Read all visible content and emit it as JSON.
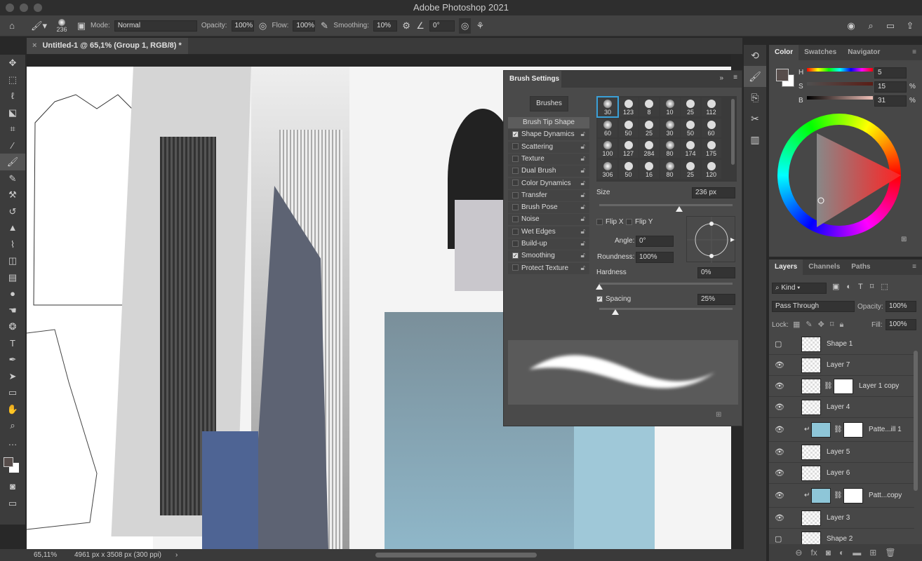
{
  "app": {
    "title": "Adobe Photoshop 2021"
  },
  "options": {
    "brush_size": "236",
    "mode_label": "Mode:",
    "mode": "Normal",
    "opacity_label": "Opacity:",
    "opacity": "100%",
    "flow_label": "Flow:",
    "flow": "100%",
    "smoothing_label": "Smoothing:",
    "smoothing": "10%",
    "angle": "0°"
  },
  "document": {
    "tab": "Untitled-1 @ 65,1% (Group 1, RGB/8) *"
  },
  "status": {
    "zoom": "65,11%",
    "size": "4961 px x 3508 px (300 ppi)"
  },
  "toolbar": {
    "tools": [
      "move",
      "marquee",
      "lasso",
      "object-select",
      "crop",
      "eyedropper",
      "brush",
      "pencil",
      "clone-stamp",
      "history-brush",
      "stamp",
      "mixer-brush",
      "eraser",
      "gradient",
      "blur",
      "smudge",
      "sponge",
      "type",
      "pen",
      "path-select",
      "rectangle",
      "hand",
      "zoom",
      "more"
    ]
  },
  "brush_settings": {
    "title": "Brush Settings",
    "brushes_button": "Brushes",
    "items": [
      {
        "label": "Brush Tip Shape",
        "checked": null
      },
      {
        "label": "Shape Dynamics",
        "checked": true
      },
      {
        "label": "Scattering",
        "checked": false
      },
      {
        "label": "Texture",
        "checked": false
      },
      {
        "label": "Dual Brush",
        "checked": false
      },
      {
        "label": "Color Dynamics",
        "checked": false
      },
      {
        "label": "Transfer",
        "checked": false
      },
      {
        "label": "Brush Pose",
        "checked": false
      },
      {
        "label": "Noise",
        "checked": false
      },
      {
        "label": "Wet Edges",
        "checked": false
      },
      {
        "label": "Build-up",
        "checked": false
      },
      {
        "label": "Smoothing",
        "checked": true
      },
      {
        "label": "Protect Texture",
        "checked": false
      }
    ],
    "tips": [
      "30",
      "123",
      "8",
      "10",
      "25",
      "112",
      "60",
      "50",
      "25",
      "30",
      "50",
      "60",
      "100",
      "127",
      "284",
      "80",
      "174",
      "175",
      "306",
      "50",
      "16",
      "80",
      "25",
      "120"
    ],
    "size_label": "Size",
    "size": "236 px",
    "size_fraction": 0.6,
    "flip_x": "Flip X",
    "flip_y": "Flip Y",
    "angle_label": "Angle:",
    "angle": "0°",
    "roundness_label": "Roundness:",
    "roundness": "100%",
    "hardness_label": "Hardness",
    "hardness": "0%",
    "spacing_label": "Spacing",
    "spacing": "25%"
  },
  "color_panel": {
    "tabs": [
      "Color",
      "Swatches",
      "Navigator"
    ],
    "h": "5",
    "s": "15",
    "b": "31",
    "h_label": "H",
    "s_label": "S",
    "b_label": "B",
    "pct": "%",
    "foreground": "#574d4b"
  },
  "layers_panel": {
    "tabs": [
      "Layers",
      "Channels",
      "Paths"
    ],
    "filter": "Kind",
    "blend": "Pass Through",
    "opacity_label": "Opacity:",
    "opacity": "100%",
    "lock_label": "Lock:",
    "fill_label": "Fill:",
    "fill": "100%",
    "layers": [
      {
        "name": "Shape 1",
        "visible": false
      },
      {
        "name": "Layer 7",
        "visible": true
      },
      {
        "name": "Layer 1 copy",
        "visible": true,
        "mask": true
      },
      {
        "name": "Layer 4",
        "visible": true
      },
      {
        "name": "Patte...ill 1",
        "visible": true,
        "mask": true,
        "clipped": true
      },
      {
        "name": "Layer 5",
        "visible": true
      },
      {
        "name": "Layer 6",
        "visible": true
      },
      {
        "name": "Patt...copy",
        "visible": true,
        "mask": true,
        "clipped": true
      },
      {
        "name": "Layer 3",
        "visible": true
      },
      {
        "name": "Shape 2",
        "visible": false
      }
    ]
  }
}
